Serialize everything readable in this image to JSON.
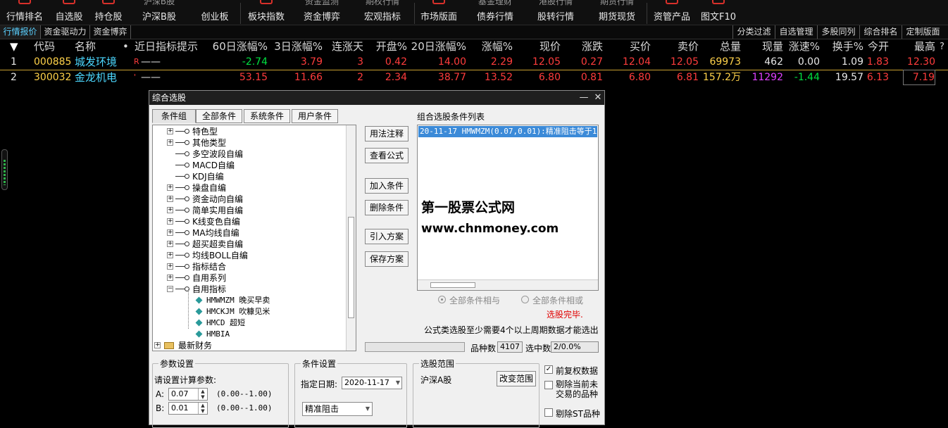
{
  "toolbar": {
    "items": [
      {
        "label": "行情排名",
        "frag": ""
      },
      {
        "label": "自选股",
        "frag": ""
      },
      {
        "label": "持仓股",
        "frag": ""
      },
      {
        "label": "沪深B股",
        "frag": "沪深B股"
      },
      {
        "label": "创业板",
        "frag": ""
      },
      {
        "label": "板块指数",
        "frag": ""
      },
      {
        "label": "资金博弈",
        "frag": "资金监测"
      },
      {
        "label": "宏观指标",
        "frag": "期权行情"
      },
      {
        "label": "市场版面",
        "frag": ""
      },
      {
        "label": "债券行情",
        "frag": "基金理财"
      },
      {
        "label": "股转行情",
        "frag": "港股行情"
      },
      {
        "label": "期货现货",
        "frag": "期货行情"
      },
      {
        "label": "资管产品",
        "frag": ""
      },
      {
        "label": "图文F10",
        "frag": ""
      }
    ]
  },
  "tabs": {
    "left": [
      "行情报价",
      "资金驱动力",
      "资金博弈"
    ],
    "right": [
      "分类过滤",
      "自选管理",
      "多股同列",
      "综合排名",
      "定制版面"
    ]
  },
  "table": {
    "sort_arrow": "▼",
    "headers": [
      "代码",
      "名称",
      "•",
      "近日指标提示",
      "60日涨幅%",
      "3日涨幅%",
      "连涨天",
      "开盘%",
      "20日涨幅%",
      "涨幅%",
      "现价",
      "涨跌",
      "买价",
      "卖价",
      "总量",
      "现量",
      "涨速%",
      "换手%",
      "今开",
      "最高",
      "?"
    ],
    "rows": [
      {
        "idx": "1",
        "code": "000885",
        "name": "城发环境",
        "flag": "R",
        "hint": "——",
        "c60": "-2.74",
        "c3": "3.79",
        "days": "3",
        "open_pct": "0.42",
        "c20": "14.00",
        "chg_pct": "2.29",
        "price": "12.05",
        "chg": "0.27",
        "bid": "12.04",
        "ask": "12.05",
        "vol": "69973",
        "curvol": "462",
        "speed": "0.00",
        "turn": "1.09",
        "open": "1.83",
        "high": "12.30"
      },
      {
        "idx": "2",
        "code": "300032",
        "name": "金龙机电",
        "flag": "'",
        "hint": "——",
        "c60": "53.15",
        "c3": "11.66",
        "days": "2",
        "open_pct": "2.34",
        "c20": "38.77",
        "chg_pct": "13.52",
        "price": "6.80",
        "chg": "0.81",
        "bid": "6.80",
        "ask": "6.81",
        "vol": "157.2万",
        "curvol": "11292",
        "speed": "-1.44",
        "turn": "19.57",
        "open": "6.13",
        "high": "7.19"
      }
    ]
  },
  "dialog": {
    "title": "综合选股",
    "minimize": "—",
    "close": "✕",
    "tabs": [
      "条件组",
      "全部条件",
      "系统条件",
      "用户条件"
    ],
    "tree": {
      "expand_plus": "+",
      "expand_minus": "−",
      "items": [
        {
          "label": "特色型",
          "type": "folder",
          "state": "collapsed",
          "indent": 0
        },
        {
          "label": "其他类型",
          "type": "folder",
          "state": "collapsed",
          "indent": 0
        },
        {
          "label": "多空波段自编",
          "type": "folder",
          "state": "leaf",
          "indent": 0
        },
        {
          "label": "MACD自编",
          "type": "folder",
          "state": "leaf",
          "indent": 0
        },
        {
          "label": "KDJ自编",
          "type": "folder",
          "state": "leaf",
          "indent": 0
        },
        {
          "label": "操盘自编",
          "type": "folder",
          "state": "collapsed",
          "indent": 0
        },
        {
          "label": "资金动向自编",
          "type": "folder",
          "state": "collapsed",
          "indent": 0
        },
        {
          "label": "简单实用自编",
          "type": "folder",
          "state": "collapsed",
          "indent": 0
        },
        {
          "label": "K线变色自编",
          "type": "folder",
          "state": "collapsed",
          "indent": 0
        },
        {
          "label": "MA均线自编",
          "type": "folder",
          "state": "collapsed",
          "indent": 0
        },
        {
          "label": "超买超卖自编",
          "type": "folder",
          "state": "collapsed",
          "indent": 0
        },
        {
          "label": "均线BOLL自编",
          "type": "folder",
          "state": "collapsed",
          "indent": 0
        },
        {
          "label": "指标结合",
          "type": "folder",
          "state": "collapsed",
          "indent": 0
        },
        {
          "label": "自用系列",
          "type": "folder",
          "state": "collapsed",
          "indent": 0
        },
        {
          "label": "自用指标",
          "type": "folder",
          "state": "expanded",
          "indent": 0
        },
        {
          "label": "HMWMZM 晚买早卖",
          "type": "formula",
          "state": "leaf",
          "indent": 1
        },
        {
          "label": "HMCKJM 吹糠见米",
          "type": "formula",
          "state": "leaf",
          "indent": 1
        },
        {
          "label": "HMCD 超短",
          "type": "formula",
          "state": "leaf",
          "indent": 1
        },
        {
          "label": "HMBIA",
          "type": "formula",
          "state": "leaf",
          "indent": 1
        },
        {
          "label": "最新财务",
          "type": "root",
          "state": "collapsed",
          "indent": -1
        }
      ]
    },
    "buttons": [
      "用法注释",
      "查看公式",
      "加入条件",
      "删除条件",
      "引入方案",
      "保存方案"
    ],
    "list_title": "组合选股条件列表",
    "list_item": "20-11-17 HMWMZM(0.07,0.01):精准阻击等于1",
    "watermark": {
      "line1": "第一股票公式网",
      "line2": "www.chnmoney.com"
    },
    "radio_and": "全部条件相与",
    "radio_or": "全部条件相或",
    "status": "选股完毕.",
    "note": "公式类选股至少需要4个以上周期数据才能选出",
    "stock_count_label": "品种数",
    "stock_count": "4107",
    "selected_label": "选中数",
    "selected": "2/0.0%",
    "params": {
      "group": "参数设置",
      "prompt": "请设置计算参数:",
      "a_label": "A:",
      "a_value": "0.07",
      "a_range": "(0.00--1.00)",
      "b_label": "B:",
      "b_value": "0.01",
      "b_range": "(0.00--1.00)"
    },
    "conditions": {
      "group": "条件设置",
      "date_label": "指定日期:",
      "date_value": "2020-11-17",
      "condition_value": "精准阻击"
    },
    "scope": {
      "group": "选股范围",
      "value": "沪深A股",
      "change_button": "改变范围"
    },
    "options": {
      "adjust": "前复权数据",
      "exclude_line1": "剔除当前未",
      "exclude_line2": "交易的品种",
      "exclude_st": "剔除ST品种",
      "check": "✓"
    }
  },
  "colors": {
    "up": "#ff3c3c",
    "down": "#00e040",
    "code": "#ffd24a",
    "name": "#4cd8ff",
    "accent": "#d8302a"
  }
}
